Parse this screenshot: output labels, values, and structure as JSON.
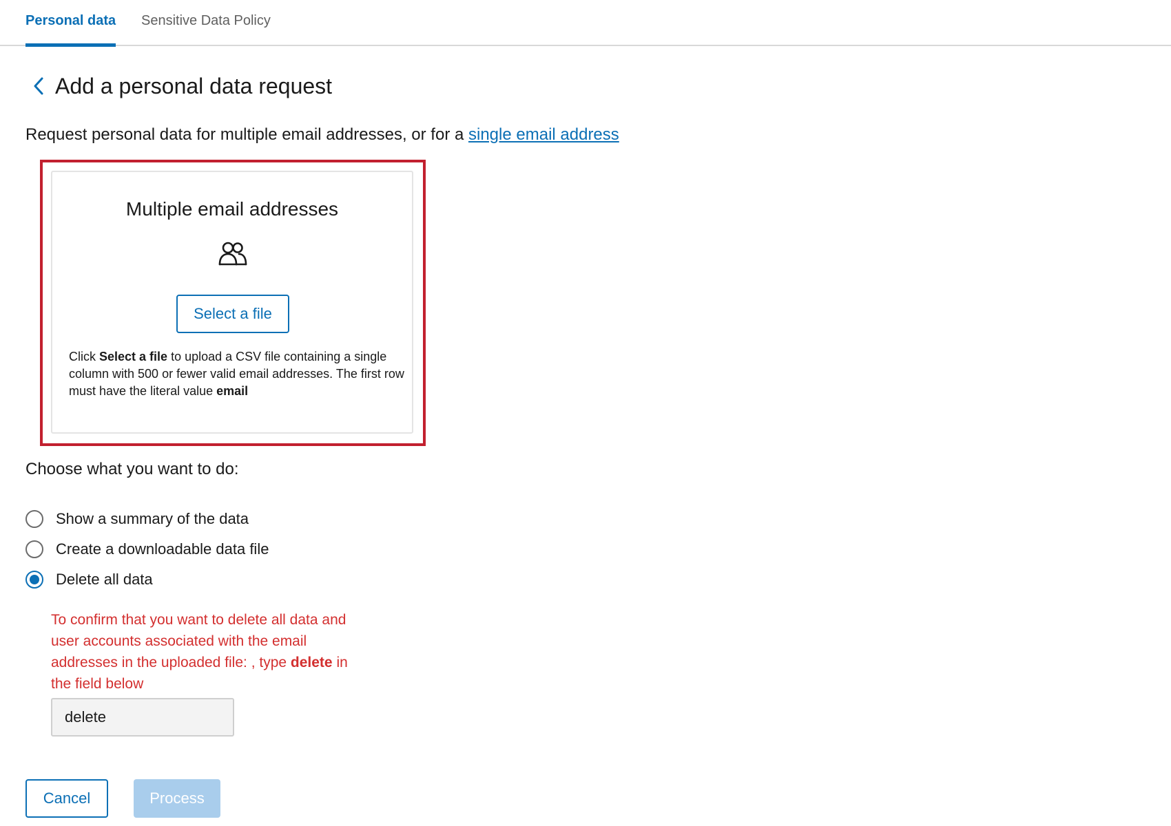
{
  "tabs": [
    {
      "label": "Personal data",
      "active": true
    },
    {
      "label": "Sensitive Data Policy",
      "active": false
    }
  ],
  "header": {
    "back_icon": "chevron-left-icon",
    "title": "Add a personal data request"
  },
  "intro": {
    "text": "Request personal data for multiple email addresses, or for a ",
    "link": "single email address"
  },
  "card": {
    "title": "Multiple email addresses",
    "icon": "people-icon",
    "button_label": "Select a file",
    "desc_1": "Click ",
    "desc_bold_1": "Select a file",
    "desc_2": " to upload a CSV file containing a single column with 500 or fewer valid email addresses. The first row must have the literal value ",
    "desc_bold_2": "email"
  },
  "choose": {
    "label": "Choose what you want to do:",
    "options": [
      {
        "label": "Show a summary of the data",
        "checked": false
      },
      {
        "label": "Create a downloadable data file",
        "checked": false
      },
      {
        "label": "Delete all data",
        "checked": true
      }
    ]
  },
  "confirm": {
    "text_1": "To confirm that you want to delete all data and user accounts associated with the email addresses in the uploaded file: , type ",
    "keyword": "delete",
    "text_2": " in the field below",
    "input_value": "delete"
  },
  "actions": {
    "cancel": "Cancel",
    "process": "Process"
  },
  "colors": {
    "accent": "#0b6fb5",
    "highlight_border": "#c2202f",
    "warning_text": "#d32f2f",
    "disabled_button": "#a9cdec"
  }
}
